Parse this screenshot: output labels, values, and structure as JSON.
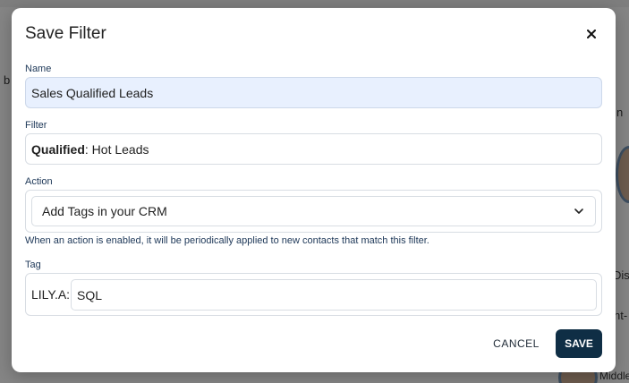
{
  "background": {
    "left_snippet": "b",
    "right_snippet_1": "Dis",
    "right_snippet_2": "nt-",
    "right_snippet_3": "Middle",
    "right_snippet_4": "n"
  },
  "modal": {
    "title": "Save Filter",
    "close_glyph": "×",
    "name": {
      "label": "Name",
      "value": "Sales Qualified Leads"
    },
    "filter": {
      "label": "Filter",
      "key": "Qualified",
      "value": ": Hot Leads"
    },
    "action": {
      "label": "Action",
      "selected": "Add Tags in your CRM",
      "hint": "When an action is enabled, it will be periodically applied to new contacts that match this filter."
    },
    "tag": {
      "label": "Tag",
      "prefix": "LILY.A:",
      "value": "SQL"
    },
    "buttons": {
      "cancel": "CANCEL",
      "save": "SAVE"
    }
  },
  "colors": {
    "primary_button": "#0f2e45",
    "label_text": "#203a5a",
    "name_field_bg": "#e8f0fe"
  }
}
